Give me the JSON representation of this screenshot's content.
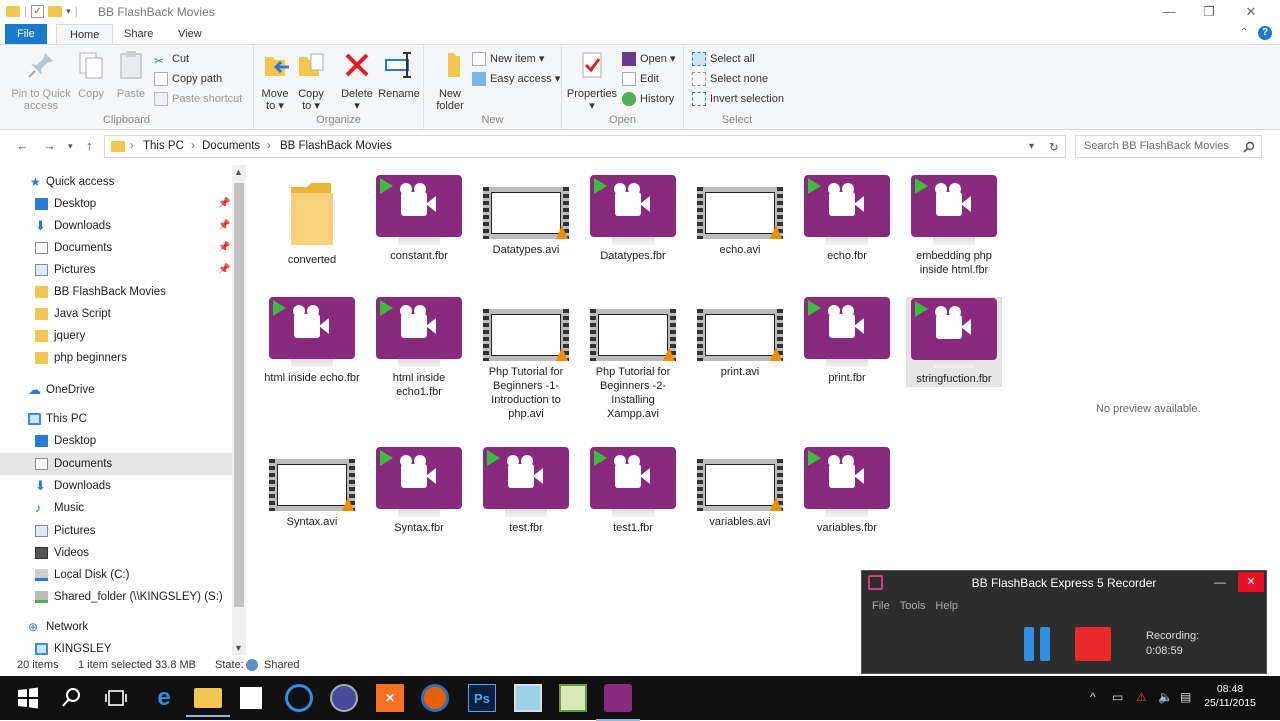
{
  "window": {
    "title": "BB FlashBack Movies",
    "minimize": "—",
    "maximize": "❐",
    "close": "✕"
  },
  "ribbon_tabs": [
    {
      "label": "File"
    },
    {
      "label": "Home"
    },
    {
      "label": "Share"
    },
    {
      "label": "View"
    }
  ],
  "ribbon": {
    "clipboard": {
      "label": "Clipboard",
      "pin": "Pin to Quick",
      "pin2": "access",
      "copy": "Copy",
      "paste": "Paste",
      "cut": "Cut",
      "copy_path": "Copy path",
      "paste_shortcut": "Paste shortcut"
    },
    "organize": {
      "label": "Organize",
      "move": "Move",
      "move2": "to ▾",
      "copy": "Copy",
      "copy2": "to ▾",
      "delete": "Delete",
      "delete2": "▾",
      "rename": "Rename"
    },
    "new": {
      "label": "New",
      "new_folder": "New",
      "new_folder2": "folder",
      "new_item": "New item ▾",
      "easy_access": "Easy access ▾"
    },
    "open": {
      "label": "Open",
      "properties": "Properties",
      "properties2": "▾",
      "open": "Open ▾",
      "edit": "Edit",
      "history": "History"
    },
    "select": {
      "label": "Select",
      "select_all": "Select all",
      "select_none": "Select none",
      "invert": "Invert selection"
    }
  },
  "address": {
    "crumbs": [
      "This PC",
      "Documents",
      "BB FlashBack Movies"
    ],
    "sep": "›",
    "search_placeholder": "Search BB FlashBack Movies"
  },
  "sidebar": {
    "quick_access": "Quick access",
    "quick_items": [
      "Desktop",
      "Downloads",
      "Documents",
      "Pictures",
      "BB FlashBack Movies",
      "Java Script",
      "jquery",
      "php beginners"
    ],
    "onedrive": "OneDrive",
    "this_pc": "This PC",
    "pc_items": [
      "Desktop",
      "Documents",
      "Downloads",
      "Music",
      "Pictures",
      "Videos",
      "Local Disk (C:)",
      "Shared_folder (\\\\KINGSLEY) (S:)"
    ],
    "network": "Network",
    "network_items": [
      "KINGSLEY"
    ]
  },
  "files": [
    {
      "name": "converted",
      "type": "folder"
    },
    {
      "name": "constant.fbr",
      "type": "fbr"
    },
    {
      "name": "Datatypes.avi",
      "type": "avi"
    },
    {
      "name": "Datatypes.fbr",
      "type": "fbr"
    },
    {
      "name": "echo.avi",
      "type": "avi"
    },
    {
      "name": "echo.fbr",
      "type": "fbr"
    },
    {
      "name": "embedding php inside html.fbr",
      "type": "fbr"
    },
    {
      "name": "html inside echo.fbr",
      "type": "fbr"
    },
    {
      "name": "html inside echo1.fbr",
      "type": "fbr"
    },
    {
      "name": "Php Tutorial for Beginners -1- Introduction to php.avi",
      "type": "avi"
    },
    {
      "name": "Php Tutorial for Beginners -2- Installing Xampp.avi",
      "type": "avi"
    },
    {
      "name": "print.avi",
      "type": "avi"
    },
    {
      "name": "print.fbr",
      "type": "fbr"
    },
    {
      "name": "stringfuction.fbr",
      "type": "fbr",
      "selected": true
    },
    {
      "name": "Syntax.avi",
      "type": "avi"
    },
    {
      "name": "Syntax.fbr",
      "type": "fbr"
    },
    {
      "name": "test.fbr",
      "type": "fbr"
    },
    {
      "name": "test1.fbr",
      "type": "fbr"
    },
    {
      "name": "variables.avi",
      "type": "avi"
    },
    {
      "name": "variables.fbr",
      "type": "fbr"
    }
  ],
  "preview": {
    "text": "No preview available."
  },
  "status": {
    "count": "20 items",
    "selected": "1 item selected  33.8 MB",
    "state_label": "State:",
    "state_value": "Shared"
  },
  "recorder": {
    "title": "BB FlashBack Express 5 Recorder",
    "menu": [
      "File",
      "Tools",
      "Help"
    ],
    "recording_label": "Recording:",
    "elapsed": "0:08:59",
    "minimize": "—",
    "close": "✕"
  },
  "clock": {
    "time": "08:48",
    "date": "25/11/2015"
  },
  "colors": {
    "accent": "#1979ca",
    "fbr_purple": "#8a2a7f",
    "record_red": "#e82a2a",
    "pause_blue": "#2f8fe0"
  }
}
